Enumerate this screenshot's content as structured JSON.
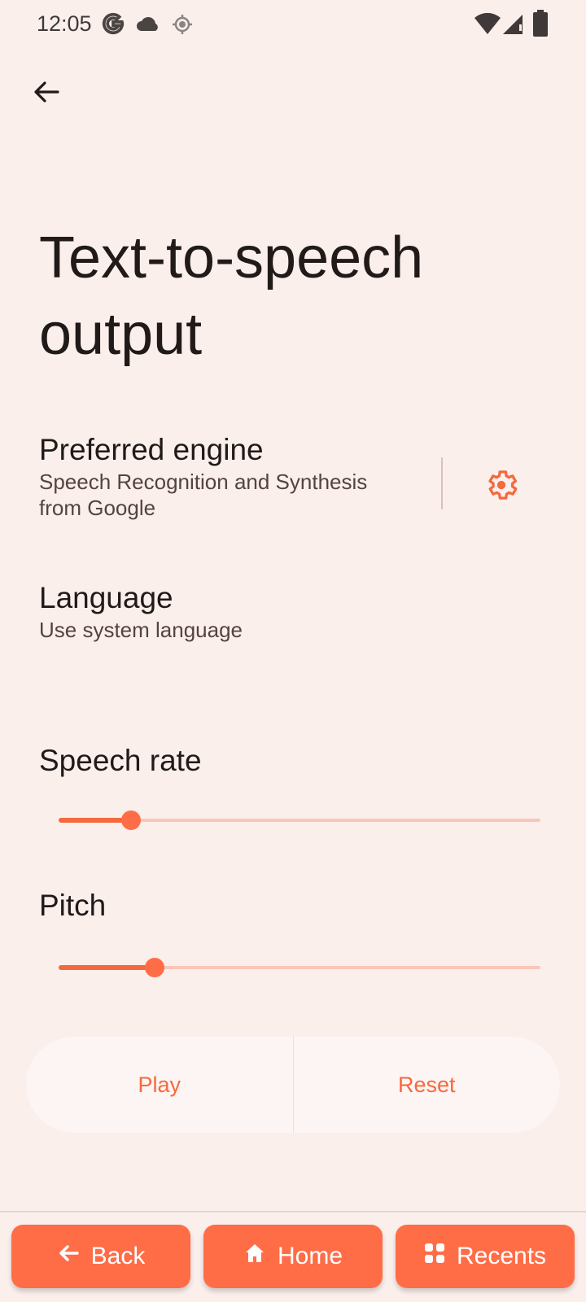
{
  "status_bar": {
    "time": "12:05",
    "icons": [
      "google-icon",
      "cloud-icon",
      "location-icon",
      "wifi-icon",
      "signal-icon",
      "battery-icon"
    ]
  },
  "header": {
    "back_icon": "arrow-back-icon"
  },
  "page_title": "Text-to-speech output",
  "preferred_engine": {
    "title": "Preferred engine",
    "summary": "Speech Recognition and Synthesis from Google",
    "settings_icon": "gear-icon"
  },
  "language": {
    "title": "Language",
    "summary": "Use system language"
  },
  "speech_rate": {
    "label": "Speech rate",
    "value_fraction": 0.15
  },
  "pitch": {
    "label": "Pitch",
    "value_fraction": 0.2
  },
  "actions": {
    "play_label": "Play",
    "reset_label": "Reset"
  },
  "nav": {
    "back_label": "Back",
    "home_label": "Home",
    "recents_label": "Recents"
  },
  "colors": {
    "accent": "#ff6d47",
    "background": "#fbefec",
    "track": "#f9c6b9"
  }
}
